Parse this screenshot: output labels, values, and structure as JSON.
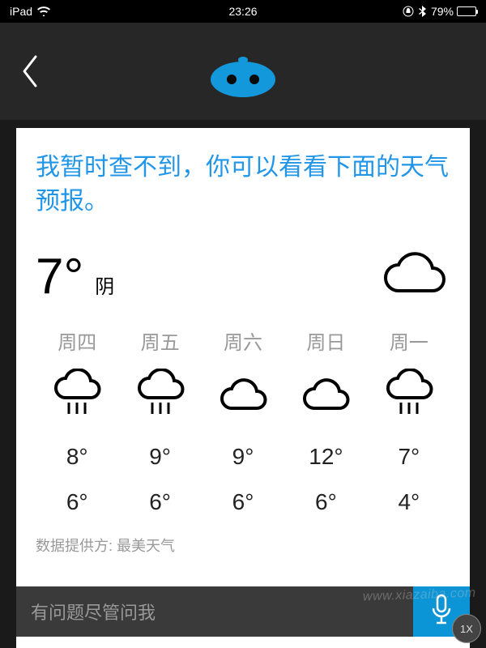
{
  "status": {
    "device": "iPad",
    "time": "23:26",
    "battery_pct": "79%"
  },
  "header": {},
  "message": "我暂时查不到，你可以看看下面的天气预报。",
  "current": {
    "temp": "7°",
    "condition": "阴"
  },
  "forecast": [
    {
      "day": "周四",
      "icon": "rain",
      "hi": "8°",
      "lo": "6°"
    },
    {
      "day": "周五",
      "icon": "rain",
      "hi": "9°",
      "lo": "6°"
    },
    {
      "day": "周六",
      "icon": "cloud",
      "hi": "9°",
      "lo": "6°"
    },
    {
      "day": "周日",
      "icon": "cloud",
      "hi": "12°",
      "lo": "6°"
    },
    {
      "day": "周一",
      "icon": "rain",
      "hi": "7°",
      "lo": "4°"
    }
  ],
  "provider": "数据提供方: 最美天气",
  "input": {
    "placeholder": "有问题尽管问我"
  },
  "zoom": "1X",
  "watermark": "www.xiazaiba.com",
  "colors": {
    "accent": "#0b94d6",
    "link": "#2196e8"
  }
}
